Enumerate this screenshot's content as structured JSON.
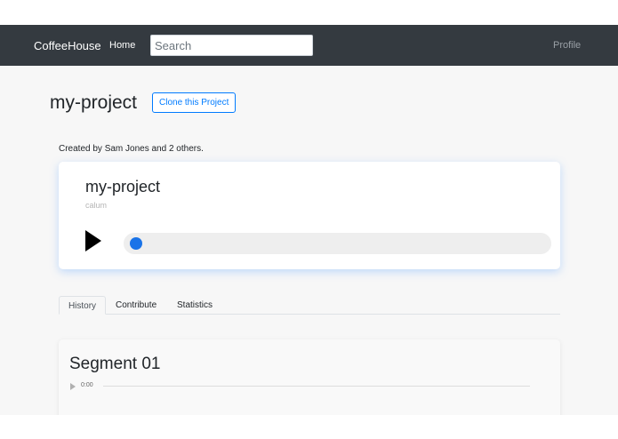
{
  "navbar": {
    "brand": "CoffeeHouse",
    "home": "Home",
    "search_placeholder": "Search",
    "profile": "Profile"
  },
  "page": {
    "title": "my-project",
    "clone_button": "Clone this Project",
    "created_by": "Created by Sam Jones and 2 others."
  },
  "player": {
    "title": "my-project",
    "author": "calum",
    "progress": 0.0,
    "knob_color": "#1a73e8"
  },
  "tabs": [
    {
      "label": "History",
      "active": true
    },
    {
      "label": "Contribute",
      "active": false
    },
    {
      "label": "Statistics",
      "active": false
    }
  ],
  "segment": {
    "title": "Segment 01",
    "time": "0:00"
  },
  "colors": {
    "navbar": "#343a40",
    "accent": "#007bff"
  }
}
